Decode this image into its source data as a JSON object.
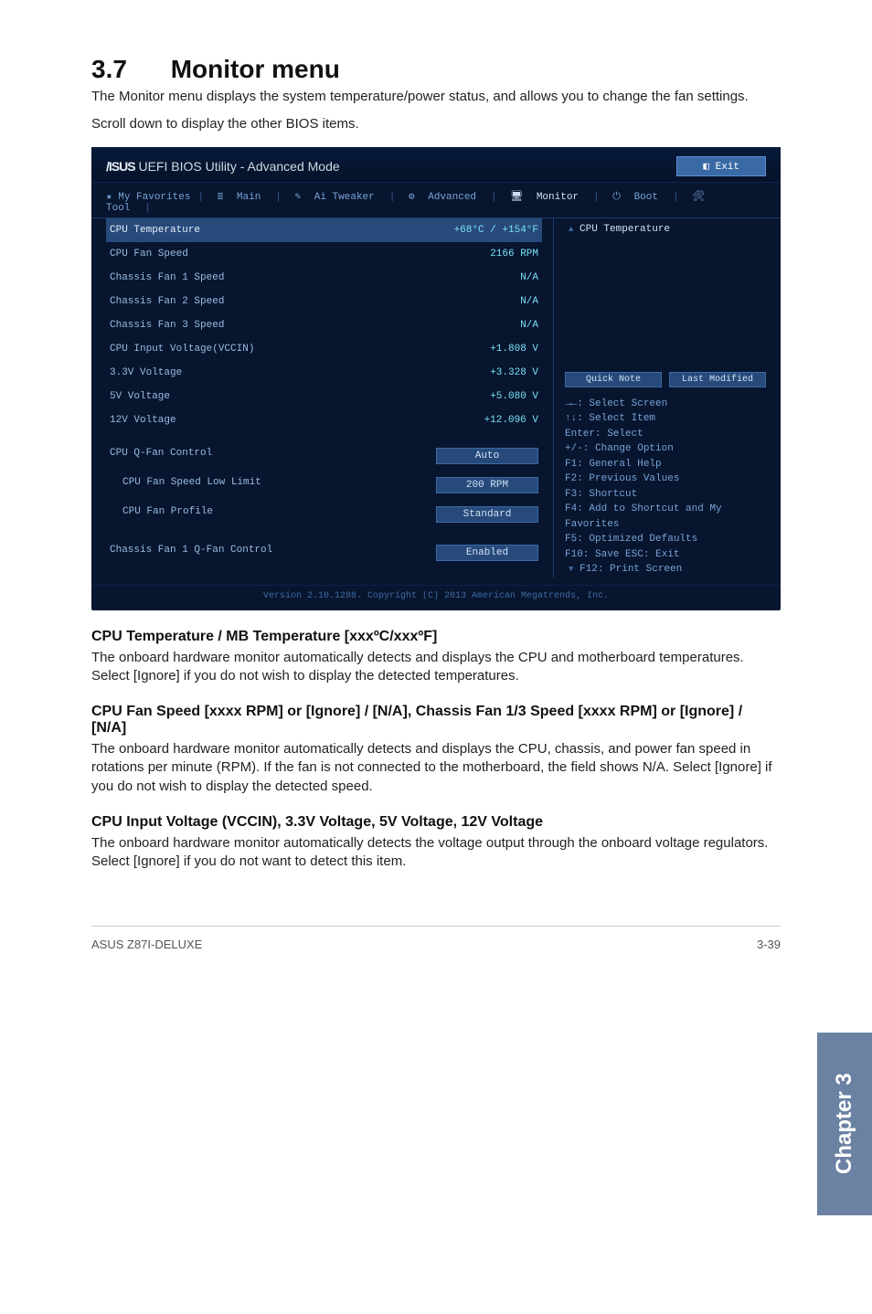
{
  "section": {
    "number": "3.7",
    "title": "Monitor menu"
  },
  "intro": [
    "The Monitor menu displays the system temperature/power status, and allows you to change the fan settings.",
    "Scroll down to display the other BIOS items."
  ],
  "bios": {
    "brandTitle": "UEFI BIOS Utility - Advanced Mode",
    "exit": "Exit",
    "tabs": {
      "fav": "★ My Favorites",
      "main": "Main",
      "tweaker": "Ai Tweaker",
      "advanced": "Advanced",
      "monitor": "Monitor",
      "boot": "Boot",
      "tool": "Tool"
    },
    "rows": {
      "cpuTemp": {
        "label": "CPU Temperature",
        "value": "+68°C / +154°F"
      },
      "cpuFanSpeed": {
        "label": "CPU Fan Speed",
        "value": "2166 RPM"
      },
      "chFan1Speed": {
        "label": "Chassis Fan 1 Speed",
        "value": "N/A"
      },
      "chFan2Speed": {
        "label": "Chassis Fan 2 Speed",
        "value": "N/A"
      },
      "chFan3Speed": {
        "label": "Chassis Fan 3 Speed",
        "value": "N/A"
      },
      "cpuInputVoltage": {
        "label": "CPU Input Voltage(VCCIN)",
        "value": "+1.808 V"
      },
      "v33": {
        "label": "3.3V Voltage",
        "value": "+3.328 V"
      },
      "v5": {
        "label": "5V Voltage",
        "value": "+5.080 V"
      },
      "v12": {
        "label": "12V Voltage",
        "value": "+12.096 V"
      },
      "cpuQfan": {
        "label": "CPU Q-Fan Control",
        "value": "Auto"
      },
      "cpuFanLow": {
        "label": "CPU Fan Speed Low Limit",
        "value": "200 RPM"
      },
      "cpuFanProfile": {
        "label": "CPU Fan Profile",
        "value": "Standard"
      },
      "chFan1Qfan": {
        "label": "Chassis Fan 1 Q-Fan Control",
        "value": "Enabled"
      }
    },
    "quickNote": "Quick Note",
    "lastModified": "Last Modified",
    "helpTitle": "CPU Temperature",
    "keyHelp": [
      "→←: Select Screen",
      "↑↓: Select Item",
      "Enter: Select",
      "+/-: Change Option",
      "F1: General Help",
      "F2: Previous Values",
      "F3: Shortcut",
      "F4: Add to Shortcut and My Favorites",
      "F5: Optimized Defaults",
      "F10: Save  ESC: Exit",
      "F12: Print Screen"
    ],
    "versionLine": "Version 2.10.1208. Copyright (C) 2013 American Megatrends, Inc."
  },
  "sections": {
    "s1": {
      "title": "CPU Temperature / MB Temperature [xxxºC/xxxºF]",
      "body": "The onboard hardware monitor automatically detects and displays the CPU and motherboard temperatures. Select [Ignore] if you do not wish to display the detected temperatures."
    },
    "s2": {
      "title": "CPU Fan Speed [xxxx RPM] or [Ignore] / [N/A], Chassis Fan 1/3 Speed [xxxx RPM] or [Ignore] / [N/A]",
      "body": "The onboard hardware monitor automatically detects and displays the CPU, chassis, and power fan speed in rotations per minute (RPM). If the fan is not connected to the motherboard, the field shows N/A. Select [Ignore] if you do not wish to display the detected speed."
    },
    "s3": {
      "title": "CPU Input Voltage (VCCIN), 3.3V Voltage, 5V Voltage, 12V Voltage",
      "body": "The onboard hardware monitor automatically detects the voltage output through the onboard voltage regulators. Select [Ignore] if you do not want to detect this item."
    }
  },
  "footer": {
    "left": "ASUS Z87I-DELUXE",
    "right": "3-39"
  },
  "sideTab": "Chapter 3"
}
